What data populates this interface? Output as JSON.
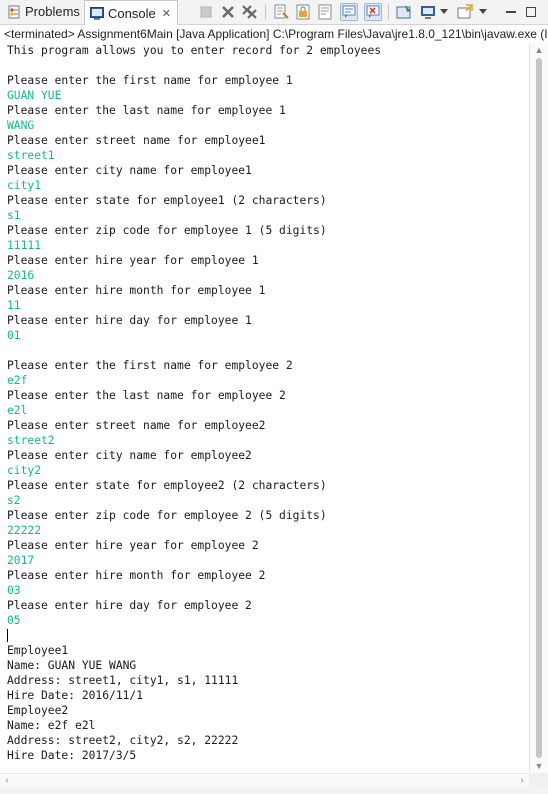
{
  "tabs": {
    "problems": "Problems",
    "console": "Console",
    "console_close": "✕"
  },
  "toolbar": {
    "buttons": [
      "terminate-icon",
      "remove-launch-icon",
      "remove-all-terminated-icon",
      "clear-console-icon",
      "scroll-lock-icon",
      "word-wrap-icon",
      "show-on-stdout-icon",
      "show-on-stderr-icon",
      "pin-console-icon",
      "display-selected-console-icon",
      "open-console-icon",
      "minimize-icon",
      "maximize-icon"
    ]
  },
  "launch_label": "<terminated> Assignment6Main [Java Application] C:\\Program Files\\Java\\jre1.8.0_121\\bin\\javaw.exe (I",
  "colors": {
    "input_text": "#16b88a",
    "output_text": "#1b1b1b"
  },
  "console_lines": [
    {
      "t": "This program allows you to enter record for 2 employees",
      "in": false
    },
    {
      "t": "",
      "in": false
    },
    {
      "t": "Please enter the first name for employee 1",
      "in": false
    },
    {
      "t": "GUAN YUE",
      "in": true
    },
    {
      "t": "Please enter the last name for employee 1",
      "in": false
    },
    {
      "t": "WANG",
      "in": true
    },
    {
      "t": "Please enter street name for employee1",
      "in": false
    },
    {
      "t": "street1",
      "in": true
    },
    {
      "t": "Please enter city name for employee1",
      "in": false
    },
    {
      "t": "city1",
      "in": true
    },
    {
      "t": "Please enter state for employee1 (2 characters)",
      "in": false
    },
    {
      "t": "s1",
      "in": true
    },
    {
      "t": "Please enter zip code for employee 1 (5 digits)",
      "in": false
    },
    {
      "t": "11111",
      "in": true
    },
    {
      "t": "Please enter hire year for employee 1",
      "in": false
    },
    {
      "t": "2016",
      "in": true
    },
    {
      "t": "Please enter hire month for employee 1",
      "in": false
    },
    {
      "t": "11",
      "in": true
    },
    {
      "t": "Please enter hire day for employee 1",
      "in": false
    },
    {
      "t": "01",
      "in": true
    },
    {
      "t": "",
      "in": false
    },
    {
      "t": "Please enter the first name for employee 2",
      "in": false
    },
    {
      "t": "e2f",
      "in": true
    },
    {
      "t": "Please enter the last name for employee 2",
      "in": false
    },
    {
      "t": "e2l",
      "in": true
    },
    {
      "t": "Please enter street name for employee2",
      "in": false
    },
    {
      "t": "street2",
      "in": true
    },
    {
      "t": "Please enter city name for employee2",
      "in": false
    },
    {
      "t": "city2",
      "in": true
    },
    {
      "t": "Please enter state for employee2 (2 characters)",
      "in": false
    },
    {
      "t": "s2",
      "in": true
    },
    {
      "t": "Please enter zip code for employee 2 (5 digits)",
      "in": false
    },
    {
      "t": "22222",
      "in": true
    },
    {
      "t": "Please enter hire year for employee 2",
      "in": false
    },
    {
      "t": "2017",
      "in": true
    },
    {
      "t": "Please enter hire month for employee 2",
      "in": false
    },
    {
      "t": "03",
      "in": true
    },
    {
      "t": "Please enter hire day for employee 2",
      "in": false
    },
    {
      "t": "05",
      "in": true
    },
    {
      "t": "",
      "in": false,
      "cursor": true
    },
    {
      "t": "Employee1",
      "in": false
    },
    {
      "t": "Name: GUAN YUE WANG",
      "in": false
    },
    {
      "t": "Address: street1, city1, s1, 11111",
      "in": false
    },
    {
      "t": "Hire Date: 2016/11/1",
      "in": false
    },
    {
      "t": "Employee2",
      "in": false
    },
    {
      "t": "Name: e2f e2l",
      "in": false
    },
    {
      "t": "Address: street2, city2, s2, 22222",
      "in": false
    },
    {
      "t": "Hire Date: 2017/3/5",
      "in": false
    }
  ]
}
